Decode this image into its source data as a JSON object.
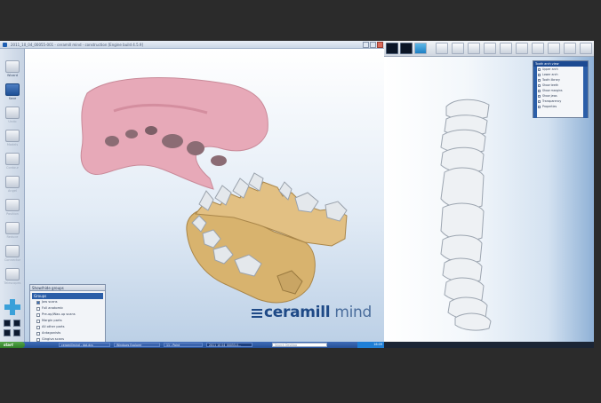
{
  "window": {
    "title": "2011_10_04_00055-001 - ceramill mind - construction [Engine build 4.5.9]",
    "controls": [
      "minimize",
      "maximize",
      "close"
    ]
  },
  "toolbar": {
    "items": [
      {
        "label": "Wizard",
        "icon": "wizard-icon",
        "state": "normal"
      },
      {
        "label": "Save",
        "icon": "save-icon",
        "state": "active"
      },
      {
        "label": "Undo",
        "icon": "undo-icon",
        "state": "dim"
      },
      {
        "label": "Models",
        "icon": "models-icon",
        "state": "dim"
      },
      {
        "label": "Contour",
        "icon": "contour-icon",
        "state": "dim"
      },
      {
        "label": "Angel",
        "icon": "angel-icon",
        "state": "dim"
      },
      {
        "label": "Position",
        "icon": "position-icon",
        "state": "dim"
      },
      {
        "label": "Reduce",
        "icon": "reduce-icon",
        "state": "dim"
      },
      {
        "label": "Connector",
        "icon": "connector-icon",
        "state": "dim"
      },
      {
        "label": "Telescopes",
        "icon": "telescopes-icon",
        "state": "dim"
      }
    ]
  },
  "brand": {
    "name_bold": "ceramill",
    "name_light": " mind"
  },
  "groups_panel": {
    "title": "Show/hide groups",
    "header": "Groups",
    "rows": [
      {
        "label": "Jaw scans",
        "checked": true
      },
      {
        "label": "Full anatomic",
        "checked": false
      },
      {
        "label": "Pre-op/Wax-up scans",
        "checked": false
      },
      {
        "label": "Margin parts",
        "checked": false
      },
      {
        "label": "All other parts",
        "checked": false
      },
      {
        "label": "Antagonists",
        "checked": false
      },
      {
        "label": "Gingiva scans",
        "checked": false
      }
    ]
  },
  "taskbar": {
    "start_label": "start",
    "tasks": [
      {
        "label": "ceramillmind - dat.dcs",
        "active": false
      },
      {
        "label": "Windows Explorer",
        "active": false
      },
      {
        "label": "11 - Paint",
        "active": false
      },
      {
        "label": "2011 10 04_00055-0...",
        "active": true
      }
    ],
    "search_placeholder": "Search Desktop",
    "clock": "16:09"
  },
  "right_panel": {
    "title": "Tooth arch view",
    "rows": [
      "Upper arch",
      "Lower arch",
      "Tooth library",
      "Show teeth",
      "Show margins",
      "Show jaws",
      "Transparency",
      "Properties"
    ]
  },
  "colors": {
    "gingiva": "#e7a9b8",
    "stone_model": "#d8b36e",
    "crown": "#e4e8ec",
    "accent": "#1e5fb3",
    "taskbar": "#2f5aa6"
  }
}
